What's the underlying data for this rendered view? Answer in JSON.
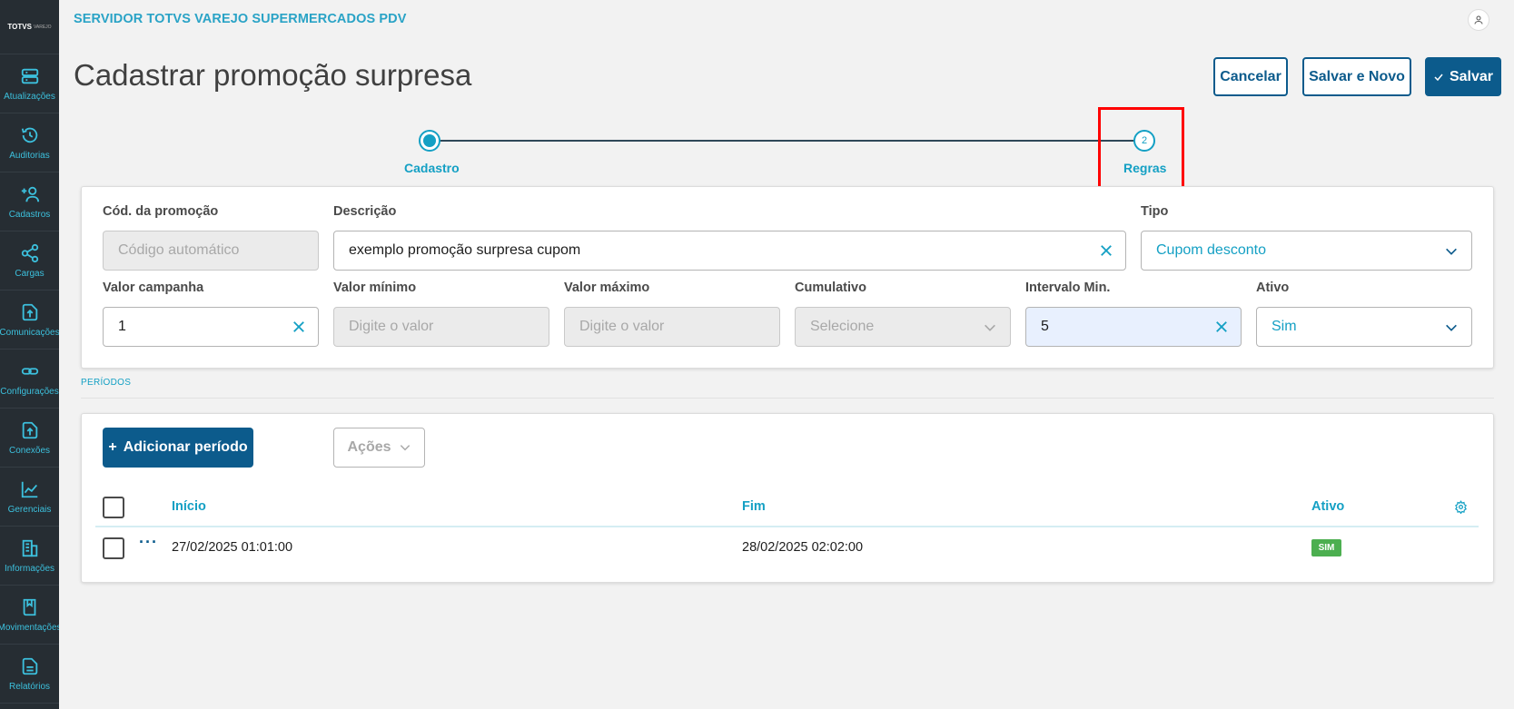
{
  "header": {
    "logo_text": "TOTVS",
    "logo_sub": "VAREJO",
    "app_title": "SERVIDOR TOTVS VAREJO SUPERMERCADOS PDV",
    "page_title": "Cadastrar promoção surpresa"
  },
  "sidebar": {
    "items": [
      {
        "label": "Atualizações",
        "icon": "server-icon"
      },
      {
        "label": "Auditorias",
        "icon": "history-icon"
      },
      {
        "label": "Cadastros",
        "icon": "add-user-icon"
      },
      {
        "label": "Cargas",
        "icon": "share-icon"
      },
      {
        "label": "Comunicações",
        "icon": "upload-file-icon"
      },
      {
        "label": "Configurações",
        "icon": "link-icon"
      },
      {
        "label": "Conexões",
        "icon": "upload-file-icon"
      },
      {
        "label": "Gerenciais",
        "icon": "chart-icon"
      },
      {
        "label": "Informações",
        "icon": "building-icon"
      },
      {
        "label": "Movimentações",
        "icon": "book-icon"
      },
      {
        "label": "Relatórios",
        "icon": "document-icon"
      }
    ]
  },
  "actions": {
    "cancel": "Cancelar",
    "save_new": "Salvar e Novo",
    "save": "Salvar"
  },
  "stepper": {
    "step1": {
      "label": "Cadastro"
    },
    "step2": {
      "number": "2",
      "label": "Regras"
    }
  },
  "form": {
    "codigo": {
      "label": "Cód. da promoção",
      "placeholder": "Código automático"
    },
    "descricao": {
      "label": "Descrição",
      "value": "exemplo promoção surpresa cupom"
    },
    "tipo": {
      "label": "Tipo",
      "value": "Cupom desconto"
    },
    "valor_campanha": {
      "label": "Valor campanha",
      "value": "1"
    },
    "valor_minimo": {
      "label": "Valor mínimo",
      "placeholder": "Digite o valor"
    },
    "valor_maximo": {
      "label": "Valor máximo",
      "placeholder": "Digite o valor"
    },
    "cumulativo": {
      "label": "Cumulativo",
      "placeholder": "Selecione"
    },
    "intervalo_min": {
      "label": "Intervalo Min.",
      "value": "5"
    },
    "ativo": {
      "label": "Ativo",
      "value": "Sim"
    }
  },
  "periodos": {
    "section_label": "PERÍODOS",
    "add_button": "Adicionar período",
    "actions_button": "Ações",
    "columns": [
      "Início",
      "Fim",
      "Ativo"
    ],
    "rows": [
      {
        "inicio": "27/02/2025 01:01:00",
        "fim": "28/02/2025 02:02:00",
        "ativo": "SIM"
      }
    ]
  },
  "colors": {
    "primary": "#0c5b8c",
    "accent": "#14a0c4",
    "sidebar": "#262d33",
    "success": "#4caf50",
    "highlight_border": "#ff0000"
  }
}
